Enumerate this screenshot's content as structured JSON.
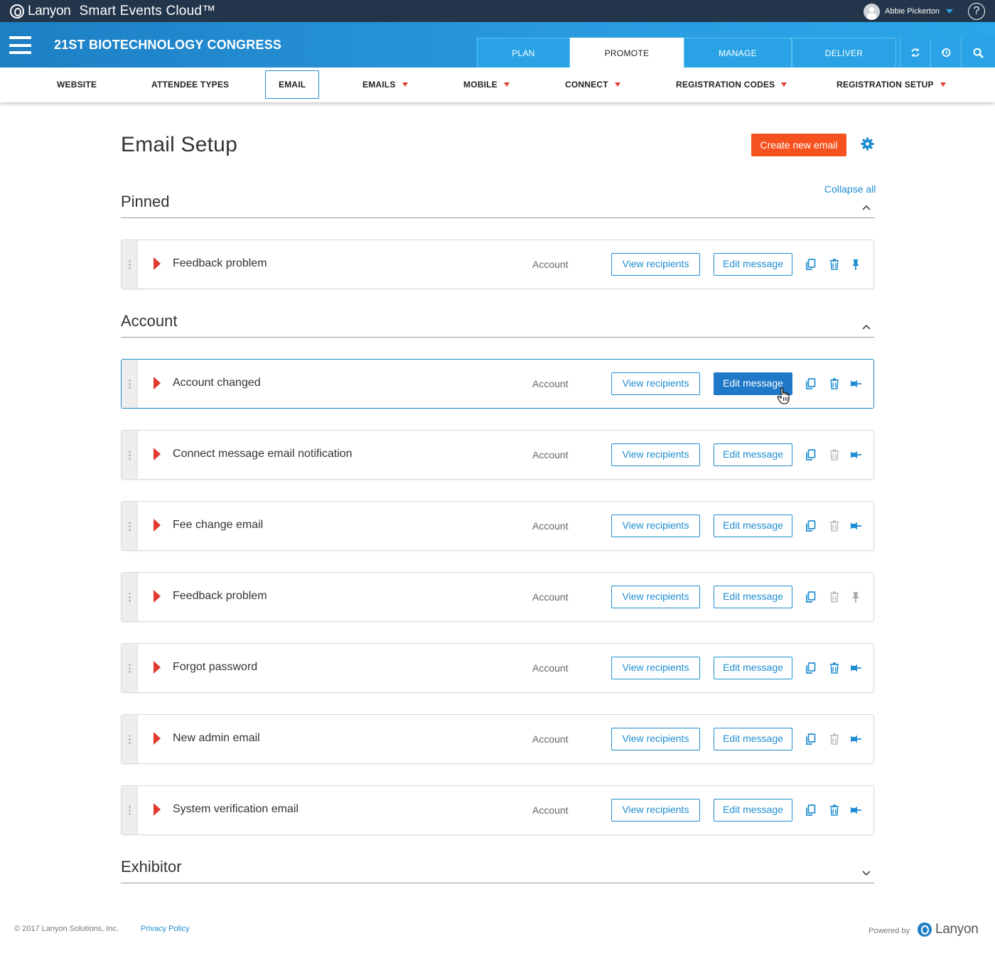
{
  "topbar": {
    "brand": "Lanyon",
    "product": "Smart Events Cloud™",
    "user_name": "Abbie Pickerton",
    "help_label": "?"
  },
  "event": {
    "title": "21ST BIOTECHNOLOGY CONGRESS",
    "tabs": [
      {
        "label": "PLAN",
        "active": false
      },
      {
        "label": "PROMOTE",
        "active": true
      },
      {
        "label": "MANAGE",
        "active": false
      },
      {
        "label": "DELIVER",
        "active": false
      }
    ],
    "icons": [
      "refresh-icon",
      "history-icon",
      "search-icon"
    ]
  },
  "subnav": {
    "items": [
      {
        "label": "WEBSITE",
        "dropdown": false
      },
      {
        "label": "ATTENDEE TYPES",
        "dropdown": false
      },
      {
        "label": "EMAIL",
        "dropdown": false,
        "active": true
      },
      {
        "label": "EMAILS",
        "dropdown": true
      },
      {
        "label": "MOBILE",
        "dropdown": true
      },
      {
        "label": "CONNECT",
        "dropdown": true
      },
      {
        "label": "REGISTRATION CODES",
        "dropdown": true
      },
      {
        "label": "REGISTRATION SETUP",
        "dropdown": true
      }
    ]
  },
  "page": {
    "title": "Email Setup",
    "create_label": "Create new email",
    "collapse_all": "Collapse all"
  },
  "sections": [
    {
      "title": "Pinned",
      "expanded": true,
      "rows": [
        {
          "name": "Feedback problem",
          "category": "Account",
          "view_label": "View recipients",
          "edit_label": "Edit message",
          "trash_enabled": true,
          "pin_state": "pinned"
        }
      ]
    },
    {
      "title": "Account",
      "expanded": true,
      "rows": [
        {
          "name": "Account changed",
          "category": "Account",
          "view_label": "View recipients",
          "edit_label": "Edit message",
          "trash_enabled": true,
          "pin_state": "unpinned",
          "selected": true
        },
        {
          "name": "Connect message email notification",
          "category": "Account",
          "view_label": "View recipients",
          "edit_label": "Edit message",
          "trash_enabled": false,
          "pin_state": "unpinned"
        },
        {
          "name": "Fee change email",
          "category": "Account",
          "view_label": "View recipients",
          "edit_label": "Edit message",
          "trash_enabled": false,
          "pin_state": "unpinned"
        },
        {
          "name": "Feedback problem",
          "category": "Account",
          "view_label": "View recipients",
          "edit_label": "Edit message",
          "trash_enabled": false,
          "pin_state": "pinned-disabled"
        },
        {
          "name": "Forgot password",
          "category": "Account",
          "view_label": "View recipients",
          "edit_label": "Edit message",
          "trash_enabled": true,
          "pin_state": "unpinned"
        },
        {
          "name": "New admin email",
          "category": "Account",
          "view_label": "View recipients",
          "edit_label": "Edit message",
          "trash_enabled": false,
          "pin_state": "unpinned"
        },
        {
          "name": "System verification email",
          "category": "Account",
          "view_label": "View recipients",
          "edit_label": "Edit message",
          "trash_enabled": true,
          "pin_state": "unpinned"
        }
      ]
    },
    {
      "title": "Exhibitor",
      "expanded": false,
      "rows": []
    }
  ],
  "footer": {
    "copyright": "© 2017 Lanyon Solutions, Inc.",
    "privacy": "Privacy Policy",
    "powered_by": "Powered by",
    "logo_text": "Lanyon"
  },
  "colors": {
    "topbar": "#22354a",
    "primary": "#1f8dd1",
    "accent_orange": "#f5521f",
    "arrow_red": "#e3382e"
  }
}
